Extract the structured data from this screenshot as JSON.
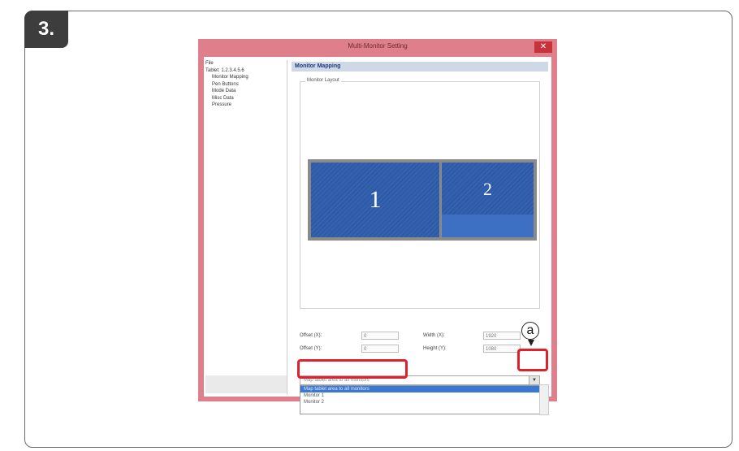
{
  "step": {
    "label": "3."
  },
  "window": {
    "title": "Multi-Monitor Setting",
    "close_glyph": "✕"
  },
  "tree": {
    "items": [
      "File",
      "Tablet: 1.2.3.4.5.6",
      "Monitor Mapping",
      "Pen Buttons",
      "Mode Data",
      "Misc Data",
      "Pressure"
    ]
  },
  "panel": {
    "title": "Monitor Mapping",
    "group_label": "Monitor Layout"
  },
  "monitors": [
    {
      "label": "1"
    },
    {
      "label": "2"
    }
  ],
  "fields": {
    "x_label": "Offset (X):",
    "x_value": "0",
    "y_label": "Offset (Y):",
    "y_value": "0",
    "w_label": "Width (X):",
    "w_value": "1920",
    "h_label": "Height (Y):",
    "h_value": "1080"
  },
  "mode_select": {
    "value": "Map tablet area to all monitors",
    "arrow": "▼"
  },
  "dropdown": {
    "options": [
      "Map tablet area to all monitors",
      "Monitor 1",
      "Monitor 2"
    ],
    "selected_index": 0
  },
  "annotation": {
    "callout": "a"
  },
  "colors": {
    "window_frame": "#e07f8c",
    "highlight": "#e0202a",
    "monitor": "#2c5aa8",
    "selection": "#3b78d4"
  }
}
